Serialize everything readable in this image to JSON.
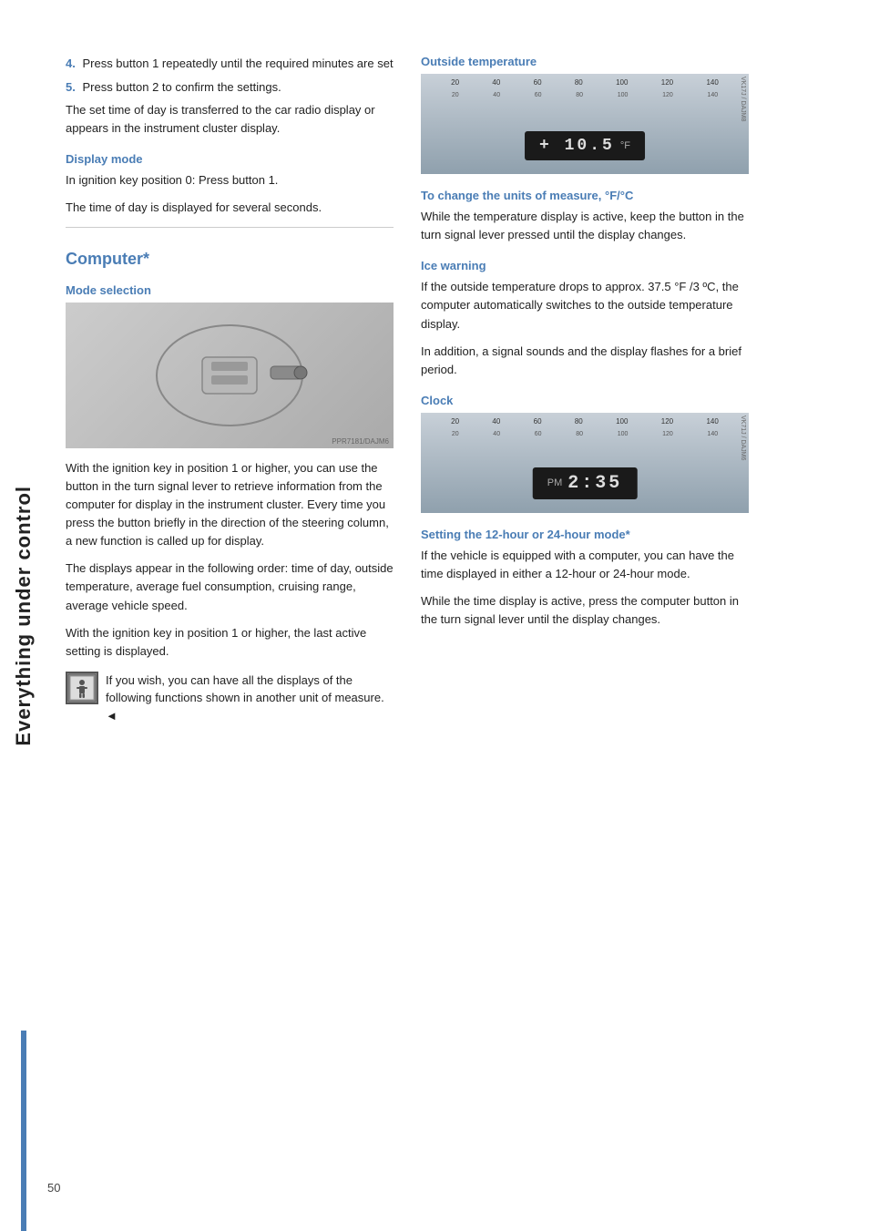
{
  "sidebar": {
    "text": "Everything under control"
  },
  "page": {
    "number": "50"
  },
  "left_column": {
    "step4": {
      "number": "4.",
      "text": "Press button 1 repeatedly until the required minutes are set"
    },
    "step5": {
      "number": "5.",
      "text": "Press button 2 to confirm the settings."
    },
    "body1": "The set time of day is transferred to the car radio display or appears in the instrument cluster display.",
    "display_mode_heading": "Display mode",
    "display_mode_body1": "In ignition key position 0: Press button 1.",
    "display_mode_body2": "The time of day is displayed for several seconds.",
    "computer_heading": "Computer*",
    "mode_selection_heading": "Mode selection",
    "mode_para1": "With the ignition key in position 1 or higher, you can use the button in the turn signal lever to retrieve information from the computer for display in the instrument cluster. Every time you press the button briefly in the direction of the steering column, a new function is called up for display.",
    "mode_para2": "The displays appear in the following order: time of day, outside temperature, average fuel consumption, cruising range, average vehicle speed.",
    "mode_para3": "With the ignition key in position 1 or higher, the last active setting is displayed.",
    "warning_text": "If you wish, you can have all the displays of the following functions shown in another unit of measure.",
    "warning_triangle": "◄"
  },
  "right_column": {
    "outside_temp_heading": "Outside temperature",
    "temp_display": "+ 10.5",
    "temp_unit": "°F",
    "change_units_heading": "To change the units of measure, °F/°C",
    "change_units_body": "While the temperature display is active, keep the button in the turn signal lever pressed until the display changes.",
    "ice_warning_heading": "Ice warning",
    "ice_warning_body1": "If the outside temperature drops to approx. 37.5 °F /3 ºC, the computer automatically switches to the outside temperature display.",
    "ice_warning_body2": "In addition, a signal sounds and the display flashes for a brief period.",
    "clock_heading": "Clock",
    "clock_pm": "PM",
    "clock_time": "2:35",
    "setting_clock_heading": "Setting the 12-hour or 24-hour mode*",
    "setting_clock_body1": "If the vehicle is equipped with a computer, you can have the time displayed in either a 12-hour or 24-hour mode.",
    "setting_clock_body2": "While the time display is active, press the computer button in the turn signal lever until the display changes.",
    "gauge_ticks_top": [
      "20",
      "40",
      "60",
      "80",
      "100",
      "120",
      "140"
    ],
    "gauge_ticks_bottom": [
      "20",
      "40",
      "60",
      "80",
      "100",
      "120",
      "140"
    ]
  }
}
